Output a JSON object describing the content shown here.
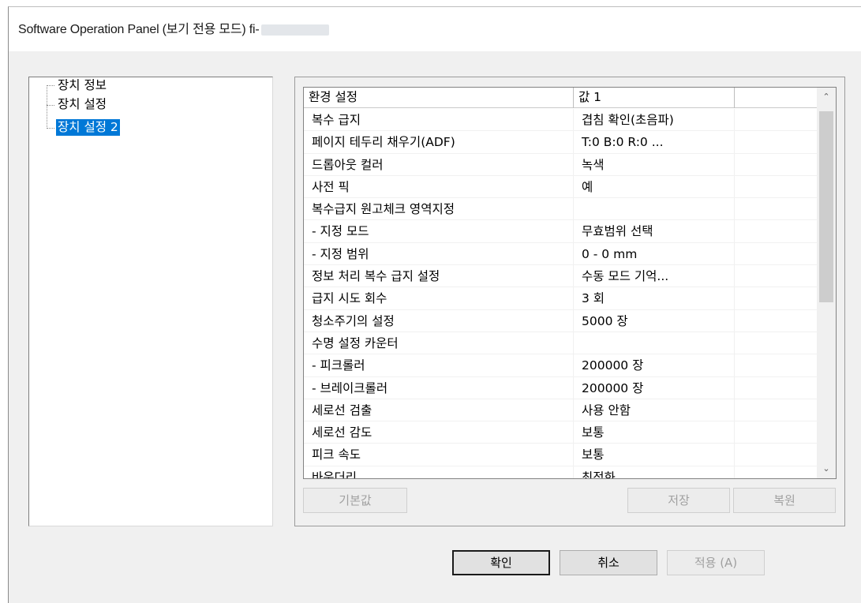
{
  "window": {
    "title": "Software Operation Panel (보기 전용 모드) fi-"
  },
  "tree": {
    "items": [
      {
        "label": "장치 정보"
      },
      {
        "label": "장치 설정"
      },
      {
        "label": "장치 설정 2"
      }
    ],
    "selected_index": 2
  },
  "list": {
    "columns": [
      "환경 설정",
      "값 1",
      ""
    ],
    "rows": [
      {
        "setting": "복수 급지",
        "value": "겹침 확인(초음파)"
      },
      {
        "setting": "페이지 테두리 채우기(ADF)",
        "value": "T:0  B:0  R:0  ..."
      },
      {
        "setting": "드롭아웃 컬러",
        "value": "녹색"
      },
      {
        "setting": "사전 픽",
        "value": "예"
      },
      {
        "setting": "복수급지 원고체크 영역지정",
        "value": ""
      },
      {
        "setting": " - 지정 모드",
        "value": "무효범위 선택"
      },
      {
        "setting": " - 지정 범위",
        "value": "0 - 0 mm"
      },
      {
        "setting": "정보 처리 복수 급지 설정",
        "value": "수동 모드  기억..."
      },
      {
        "setting": "급지 시도 회수",
        "value": "3 회"
      },
      {
        "setting": "청소주기의 설정",
        "value": "5000 장"
      },
      {
        "setting": "수명 설정 카운터",
        "value": ""
      },
      {
        "setting": " - 피크롤러",
        "value": "200000 장"
      },
      {
        "setting": " - 브레이크롤러",
        "value": "200000 장"
      },
      {
        "setting": "세로선 검출",
        "value": "사용 안함"
      },
      {
        "setting": "세로선 감도",
        "value": "보통"
      },
      {
        "setting": "피크 속도",
        "value": "보통"
      },
      {
        "setting": "바운더리",
        "value": "최적화"
      }
    ]
  },
  "panel_buttons": {
    "default_label": "기본값",
    "save_label": "저장",
    "restore_label": "복원"
  },
  "dialog_buttons": {
    "ok_label": "확인",
    "cancel_label": "취소",
    "apply_label": "적용 (A)"
  }
}
